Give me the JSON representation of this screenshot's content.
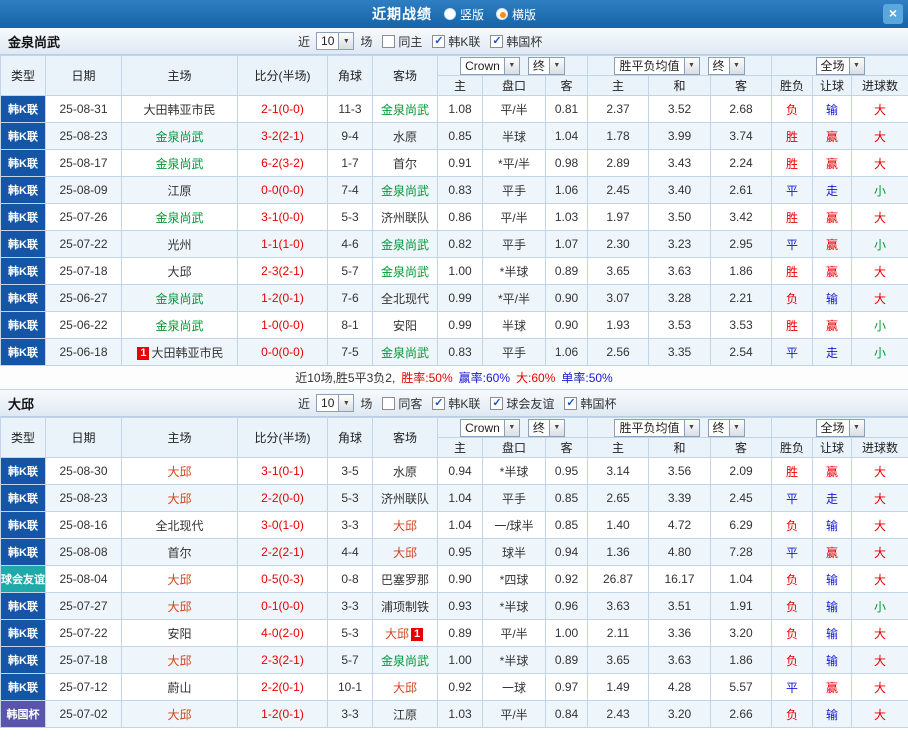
{
  "titlebar": {
    "title": "近期战绩",
    "radios": [
      {
        "label": "竖版",
        "selected": false
      },
      {
        "label": "横版",
        "selected": true
      }
    ],
    "close_glyph": "×"
  },
  "controls_shared": {
    "near": "近",
    "count": "10",
    "games": "场"
  },
  "table_header": {
    "static_cols": [
      "类型",
      "日期",
      "主场",
      "比分(半场)",
      "角球",
      "客场"
    ],
    "odds_group": {
      "bookmaker": "Crown",
      "final": "终"
    },
    "avg_group": {
      "label": "胜平负均值",
      "final": "终"
    },
    "full_group": {
      "label": "全场"
    },
    "sub_cols": [
      "主",
      "盘口",
      "客",
      "主",
      "和",
      "客",
      "胜负",
      "让球",
      "进球数"
    ]
  },
  "colors": {
    "titlebar_blue": "#1563a8",
    "league_kleague": "#1455a5",
    "league_friendly": "#21a8a8",
    "league_cup": "#5a55aa",
    "team_highlight_green": "#009933",
    "team_highlight_red": "#d2451c",
    "score_red": "#e80000",
    "result_red": "#e80000",
    "result_blue": "#1616d9",
    "result_green": "#009933",
    "radio_selected_dot": "#ff9000"
  },
  "sections": [
    {
      "team": "金泉尚武",
      "checkboxes": [
        {
          "label": "同主",
          "checked": false
        },
        {
          "label": "韩K联",
          "checked": true
        },
        {
          "label": "韩国杯",
          "checked": true
        }
      ],
      "rows": [
        {
          "league": "韩K联",
          "lg": "k",
          "date": "25-08-31",
          "home": {
            "name": "大田韩亚市民",
            "hl": null,
            "card": null
          },
          "score": "2-1(0-0)",
          "corner": "11-3",
          "away": {
            "name": "金泉尚武",
            "hl": "green",
            "card": null
          },
          "odds": [
            "1.08",
            "平/半",
            "0.81"
          ],
          "avg": [
            "2.37",
            "3.52",
            "2.68"
          ],
          "results": [
            [
              "负",
              "red"
            ],
            [
              "输",
              "blue"
            ],
            [
              "大",
              "red"
            ]
          ]
        },
        {
          "league": "韩K联",
          "lg": "k",
          "date": "25-08-23",
          "home": {
            "name": "金泉尚武",
            "hl": "green",
            "card": null
          },
          "score": "3-2(2-1)",
          "corner": "9-4",
          "away": {
            "name": "水原",
            "hl": null,
            "card": null
          },
          "odds": [
            "0.85",
            "半球",
            "1.04"
          ],
          "avg": [
            "1.78",
            "3.99",
            "3.74"
          ],
          "results": [
            [
              "胜",
              "red"
            ],
            [
              "赢",
              "red"
            ],
            [
              "大",
              "red"
            ]
          ]
        },
        {
          "league": "韩K联",
          "lg": "k",
          "date": "25-08-17",
          "home": {
            "name": "金泉尚武",
            "hl": "green",
            "card": null
          },
          "score": "6-2(3-2)",
          "corner": "1-7",
          "away": {
            "name": "首尔",
            "hl": null,
            "card": null
          },
          "odds": [
            "0.91",
            "*平/半",
            "0.98"
          ],
          "avg": [
            "2.89",
            "3.43",
            "2.24"
          ],
          "results": [
            [
              "胜",
              "red"
            ],
            [
              "赢",
              "red"
            ],
            [
              "大",
              "red"
            ]
          ]
        },
        {
          "league": "韩K联",
          "lg": "k",
          "date": "25-08-09",
          "home": {
            "name": "江原",
            "hl": null,
            "card": null
          },
          "score": "0-0(0-0)",
          "corner": "7-4",
          "away": {
            "name": "金泉尚武",
            "hl": "green",
            "card": null
          },
          "odds": [
            "0.83",
            "平手",
            "1.06"
          ],
          "avg": [
            "2.45",
            "3.40",
            "2.61"
          ],
          "results": [
            [
              "平",
              "blue"
            ],
            [
              "走",
              "blue"
            ],
            [
              "小",
              "green"
            ]
          ]
        },
        {
          "league": "韩K联",
          "lg": "k",
          "date": "25-07-26",
          "home": {
            "name": "金泉尚武",
            "hl": "green",
            "card": null
          },
          "score": "3-1(0-0)",
          "corner": "5-3",
          "away": {
            "name": "济州联队",
            "hl": null,
            "card": null
          },
          "odds": [
            "0.86",
            "平/半",
            "1.03"
          ],
          "avg": [
            "1.97",
            "3.50",
            "3.42"
          ],
          "results": [
            [
              "胜",
              "red"
            ],
            [
              "赢",
              "red"
            ],
            [
              "大",
              "red"
            ]
          ]
        },
        {
          "league": "韩K联",
          "lg": "k",
          "date": "25-07-22",
          "home": {
            "name": "光州",
            "hl": null,
            "card": null
          },
          "score": "1-1(1-0)",
          "corner": "4-6",
          "away": {
            "name": "金泉尚武",
            "hl": "green",
            "card": null
          },
          "odds": [
            "0.82",
            "平手",
            "1.07"
          ],
          "avg": [
            "2.30",
            "3.23",
            "2.95"
          ],
          "results": [
            [
              "平",
              "blue"
            ],
            [
              "赢",
              "red"
            ],
            [
              "小",
              "green"
            ]
          ]
        },
        {
          "league": "韩K联",
          "lg": "k",
          "date": "25-07-18",
          "home": {
            "name": "大邱",
            "hl": null,
            "card": null
          },
          "score": "2-3(2-1)",
          "corner": "5-7",
          "away": {
            "name": "金泉尚武",
            "hl": "green",
            "card": null
          },
          "odds": [
            "1.00",
            "*半球",
            "0.89"
          ],
          "avg": [
            "3.65",
            "3.63",
            "1.86"
          ],
          "results": [
            [
              "胜",
              "red"
            ],
            [
              "赢",
              "red"
            ],
            [
              "大",
              "red"
            ]
          ]
        },
        {
          "league": "韩K联",
          "lg": "k",
          "date": "25-06-27",
          "home": {
            "name": "金泉尚武",
            "hl": "green",
            "card": null
          },
          "score": "1-2(0-1)",
          "corner": "7-6",
          "away": {
            "name": "全北现代",
            "hl": null,
            "card": null
          },
          "odds": [
            "0.99",
            "*平/半",
            "0.90"
          ],
          "avg": [
            "3.07",
            "3.28",
            "2.21"
          ],
          "results": [
            [
              "负",
              "red"
            ],
            [
              "输",
              "blue"
            ],
            [
              "大",
              "red"
            ]
          ]
        },
        {
          "league": "韩K联",
          "lg": "k",
          "date": "25-06-22",
          "home": {
            "name": "金泉尚武",
            "hl": "green",
            "card": null
          },
          "score": "1-0(0-0)",
          "corner": "8-1",
          "away": {
            "name": "安阳",
            "hl": null,
            "card": null
          },
          "odds": [
            "0.99",
            "半球",
            "0.90"
          ],
          "avg": [
            "1.93",
            "3.53",
            "3.53"
          ],
          "results": [
            [
              "胜",
              "red"
            ],
            [
              "赢",
              "red"
            ],
            [
              "小",
              "green"
            ]
          ]
        },
        {
          "league": "韩K联",
          "lg": "k",
          "date": "25-06-18",
          "home": {
            "name": "大田韩亚市民",
            "hl": null,
            "card": {
              "pos": "before",
              "text": "1"
            }
          },
          "score": "0-0(0-0)",
          "corner": "7-5",
          "away": {
            "name": "金泉尚武",
            "hl": "green",
            "card": null
          },
          "odds": [
            "0.83",
            "平手",
            "1.06"
          ],
          "avg": [
            "2.56",
            "3.35",
            "2.54"
          ],
          "results": [
            [
              "平",
              "blue"
            ],
            [
              "走",
              "blue"
            ],
            [
              "小",
              "green"
            ]
          ]
        }
      ],
      "summary": [
        {
          "text": "近10场,胜5平3负2,",
          "color": "dark"
        },
        {
          "text": "胜率:50%",
          "color": "red"
        },
        {
          "text": "赢率:60%",
          "color": "blue"
        },
        {
          "text": "大:60%",
          "color": "red"
        },
        {
          "text": "单率:50%",
          "color": "blue"
        }
      ]
    },
    {
      "team": "大邱",
      "checkboxes": [
        {
          "label": "同客",
          "checked": false
        },
        {
          "label": "韩K联",
          "checked": true
        },
        {
          "label": "球会友谊",
          "checked": true
        },
        {
          "label": "韩国杯",
          "checked": true
        }
      ],
      "rows": [
        {
          "league": "韩K联",
          "lg": "k",
          "date": "25-08-30",
          "home": {
            "name": "大邱",
            "hl": "red",
            "card": null
          },
          "score": "3-1(0-1)",
          "corner": "3-5",
          "away": {
            "name": "水原",
            "hl": null,
            "card": null
          },
          "odds": [
            "0.94",
            "*半球",
            "0.95"
          ],
          "avg": [
            "3.14",
            "3.56",
            "2.09"
          ],
          "results": [
            [
              "胜",
              "red"
            ],
            [
              "赢",
              "red"
            ],
            [
              "大",
              "red"
            ]
          ]
        },
        {
          "league": "韩K联",
          "lg": "k",
          "date": "25-08-23",
          "home": {
            "name": "大邱",
            "hl": "red",
            "card": null
          },
          "score": "2-2(0-0)",
          "corner": "5-3",
          "away": {
            "name": "济州联队",
            "hl": null,
            "card": null
          },
          "odds": [
            "1.04",
            "平手",
            "0.85"
          ],
          "avg": [
            "2.65",
            "3.39",
            "2.45"
          ],
          "results": [
            [
              "平",
              "blue"
            ],
            [
              "走",
              "blue"
            ],
            [
              "大",
              "red"
            ]
          ]
        },
        {
          "league": "韩K联",
          "lg": "k",
          "date": "25-08-16",
          "home": {
            "name": "全北现代",
            "hl": null,
            "card": null
          },
          "score": "3-0(1-0)",
          "corner": "3-3",
          "away": {
            "name": "大邱",
            "hl": "red",
            "card": null
          },
          "odds": [
            "1.04",
            "一/球半",
            "0.85"
          ],
          "avg": [
            "1.40",
            "4.72",
            "6.29"
          ],
          "results": [
            [
              "负",
              "red"
            ],
            [
              "输",
              "blue"
            ],
            [
              "大",
              "red"
            ]
          ]
        },
        {
          "league": "韩K联",
          "lg": "k",
          "date": "25-08-08",
          "home": {
            "name": "首尔",
            "hl": null,
            "card": null
          },
          "score": "2-2(2-1)",
          "corner": "4-4",
          "away": {
            "name": "大邱",
            "hl": "red",
            "card": null
          },
          "odds": [
            "0.95",
            "球半",
            "0.94"
          ],
          "avg": [
            "1.36",
            "4.80",
            "7.28"
          ],
          "results": [
            [
              "平",
              "blue"
            ],
            [
              "赢",
              "red"
            ],
            [
              "大",
              "red"
            ]
          ]
        },
        {
          "league": "球会友谊",
          "lg": "f",
          "date": "25-08-04",
          "home": {
            "name": "大邱",
            "hl": "red",
            "card": null
          },
          "score": "0-5(0-3)",
          "corner": "0-8",
          "away": {
            "name": "巴塞罗那",
            "hl": null,
            "card": null
          },
          "odds": [
            "0.90",
            "*四球",
            "0.92"
          ],
          "avg": [
            "26.87",
            "16.17",
            "1.04"
          ],
          "results": [
            [
              "负",
              "red"
            ],
            [
              "输",
              "blue"
            ],
            [
              "大",
              "red"
            ]
          ]
        },
        {
          "league": "韩K联",
          "lg": "k",
          "date": "25-07-27",
          "home": {
            "name": "大邱",
            "hl": "red",
            "card": null
          },
          "score": "0-1(0-0)",
          "corner": "3-3",
          "away": {
            "name": "浦项制铁",
            "hl": null,
            "card": null
          },
          "odds": [
            "0.93",
            "*半球",
            "0.96"
          ],
          "avg": [
            "3.63",
            "3.51",
            "1.91"
          ],
          "results": [
            [
              "负",
              "red"
            ],
            [
              "输",
              "blue"
            ],
            [
              "小",
              "green"
            ]
          ]
        },
        {
          "league": "韩K联",
          "lg": "k",
          "date": "25-07-22",
          "home": {
            "name": "安阳",
            "hl": null,
            "card": null
          },
          "score": "4-0(2-0)",
          "corner": "5-3",
          "away": {
            "name": "大邱",
            "hl": "red",
            "card": {
              "pos": "after",
              "text": "1"
            }
          },
          "odds": [
            "0.89",
            "平/半",
            "1.00"
          ],
          "avg": [
            "2.11",
            "3.36",
            "3.20"
          ],
          "results": [
            [
              "负",
              "red"
            ],
            [
              "输",
              "blue"
            ],
            [
              "大",
              "red"
            ]
          ]
        },
        {
          "league": "韩K联",
          "lg": "k",
          "date": "25-07-18",
          "home": {
            "name": "大邱",
            "hl": "red",
            "card": null
          },
          "score": "2-3(2-1)",
          "corner": "5-7",
          "away": {
            "name": "金泉尚武",
            "hl": "green",
            "card": null
          },
          "odds": [
            "1.00",
            "*半球",
            "0.89"
          ],
          "avg": [
            "3.65",
            "3.63",
            "1.86"
          ],
          "results": [
            [
              "负",
              "red"
            ],
            [
              "输",
              "blue"
            ],
            [
              "大",
              "red"
            ]
          ]
        },
        {
          "league": "韩K联",
          "lg": "k",
          "date": "25-07-12",
          "home": {
            "name": "蔚山",
            "hl": null,
            "card": null
          },
          "score": "2-2(0-1)",
          "corner": "10-1",
          "away": {
            "name": "大邱",
            "hl": "red",
            "card": null
          },
          "odds": [
            "0.92",
            "一球",
            "0.97"
          ],
          "avg": [
            "1.49",
            "4.28",
            "5.57"
          ],
          "results": [
            [
              "平",
              "blue"
            ],
            [
              "赢",
              "red"
            ],
            [
              "大",
              "red"
            ]
          ]
        },
        {
          "league": "韩国杯",
          "lg": "c",
          "date": "25-07-02",
          "home": {
            "name": "大邱",
            "hl": "red",
            "card": null
          },
          "score": "1-2(0-1)",
          "corner": "3-3",
          "away": {
            "name": "江原",
            "hl": null,
            "card": null
          },
          "odds": [
            "1.03",
            "平/半",
            "0.84"
          ],
          "avg": [
            "2.43",
            "3.20",
            "2.66"
          ],
          "results": [
            [
              "负",
              "red"
            ],
            [
              "输",
              "blue"
            ],
            [
              "大",
              "red"
            ]
          ]
        }
      ],
      "summary": null
    }
  ]
}
